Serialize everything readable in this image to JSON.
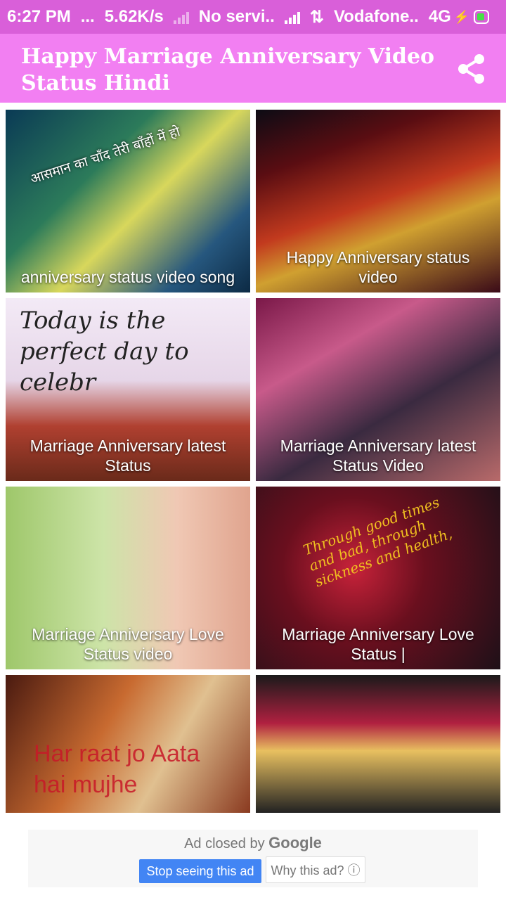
{
  "status_bar": {
    "time": "6:27 PM",
    "dots": "...",
    "speed": "5.62K/s",
    "sim1": "No servi..",
    "sim2": "Vodafone..",
    "network": "4G"
  },
  "app_bar": {
    "title": "Happy Marriage Anniversary Video Status Hindi",
    "accent": "#f27ff2",
    "status_color": "#d95fd9"
  },
  "videos": [
    {
      "title": "anniversary status video song",
      "overlay": "आसमान का चाँद तेरी बाँहों में हो"
    },
    {
      "title": "Happy Anniversary status video"
    },
    {
      "title": "Marriage Anniversary latest Status",
      "overlay": "Today is the perfect day to celebr"
    },
    {
      "title": "Marriage Anniversary latest Status Video"
    },
    {
      "title": "Marriage Anniversary Love Status video"
    },
    {
      "title": "Marriage Anniversary Love Status |",
      "overlay": "Through good times and bad, through sickness and health,"
    },
    {
      "title": "",
      "overlay": "Har raat jo Aata hai mujhe"
    },
    {
      "title": ""
    }
  ],
  "ad": {
    "closed_text": "Ad closed by",
    "brand": "Google",
    "stop_label": "Stop seeing this ad",
    "why_label": "Why this ad? ⓘ"
  }
}
